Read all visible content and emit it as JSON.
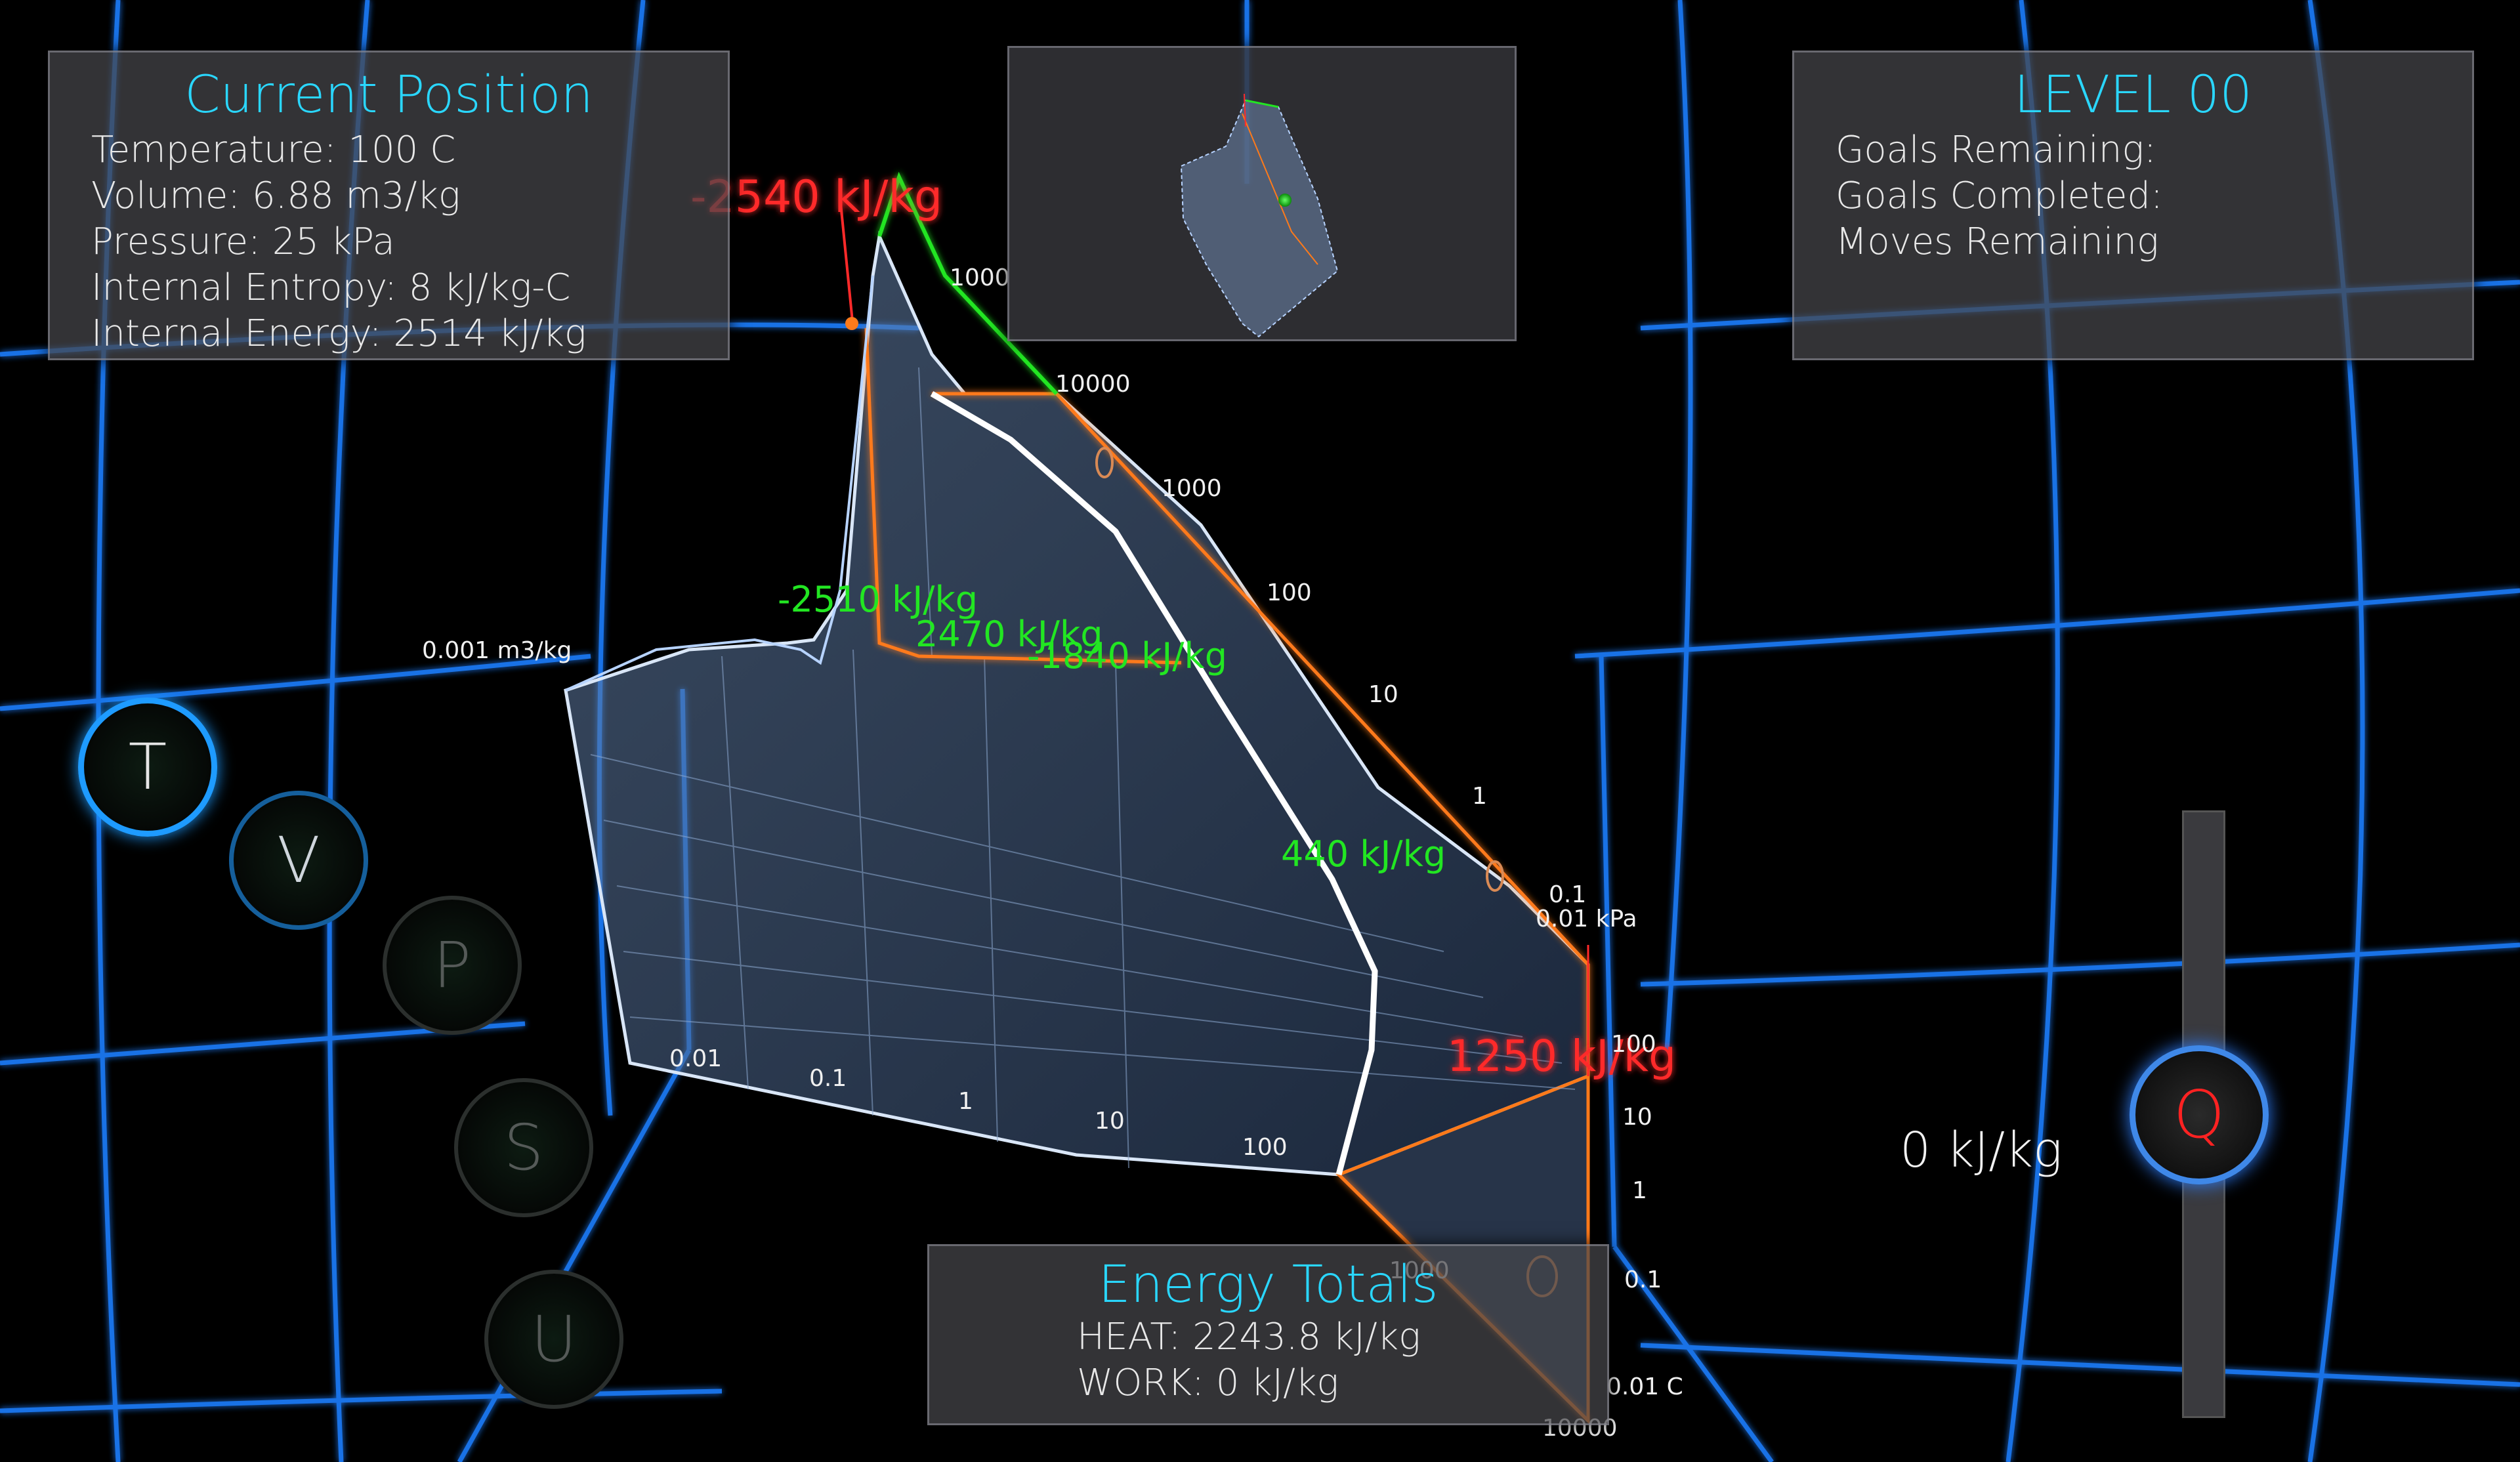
{
  "current_position": {
    "title": "Current Position",
    "temperature": "Temperature: 100 C",
    "volume": "Volume: 6.88 m3/kg",
    "pressure": "Pressure: 25 kPa",
    "entropy": "Internal Entropy: 8 kJ/kg-C",
    "energy": "Internal Energy: 2514 kJ/kg"
  },
  "level": {
    "title": "LEVEL 00",
    "goals_remaining": "Goals Remaining:",
    "goals_completed": "Goals Completed:",
    "moves_remaining": "Moves Remaining"
  },
  "energy_totals": {
    "title": "Energy Totals",
    "heat": "HEAT: 2243.8 kJ/kg",
    "work": "WORK: 0 kJ/kg"
  },
  "variable_buttons": [
    "T",
    "V",
    "P",
    "S",
    "U"
  ],
  "active_variable": "T",
  "heat_control": {
    "label": "Q",
    "value_text": "0 kJ/kg"
  },
  "annotations": {
    "peak": "-2540 kJ/kg",
    "green1": "-2510 kJ/kg",
    "green2": "2470 kJ/kg",
    "green3": "-1840 kJ/kg",
    "green4": "440 kJ/kg",
    "red_right": "1250 kJ/kg"
  },
  "axis_labels": {
    "volume_axis": [
      "0.001 m3/kg",
      "0.01",
      "0.1",
      "1",
      "10",
      "100",
      "1000",
      "10000"
    ],
    "pressure_axis": [
      "1000",
      "10000",
      "1000",
      "100",
      "10",
      "1",
      "0.1",
      "0.01 kPa"
    ],
    "temperature_axis": [
      "100",
      "10",
      "1",
      "0.1",
      "0.01 C"
    ]
  },
  "colors": {
    "grid": "#1f7fff",
    "accent": "#2ad7ff",
    "green_label": "#22e622",
    "red_label": "#ff2a2a",
    "orange_edge": "#ff7a1a",
    "path": "#ffffff"
  }
}
